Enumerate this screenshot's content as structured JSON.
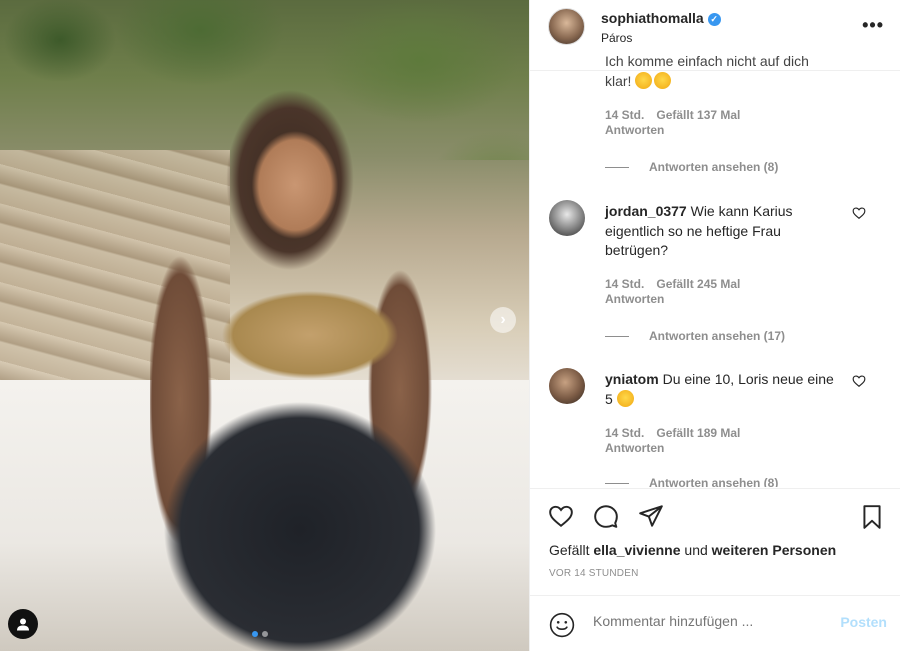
{
  "post": {
    "username": "sophiathomalla",
    "location": "Páros",
    "more_label": "•••"
  },
  "comments": [
    {
      "text_partial": "Ich komme einfach nicht auf dich",
      "text_end": "klar!",
      "time": "14 Std.",
      "likes": "Gefällt 137 Mal",
      "reply": "Antworten",
      "view_replies": "Antworten ansehen (8)"
    },
    {
      "username": "jordan_0377",
      "text": "Wie kann Karius eigentlich so ne heftige Frau betrügen?",
      "time": "14 Std.",
      "likes": "Gefällt 245 Mal",
      "reply": "Antworten",
      "view_replies": "Antworten ansehen (17)"
    },
    {
      "username": "yniatom",
      "text": "Du eine 10, Loris neue eine 5",
      "time": "14 Std.",
      "likes": "Gefällt 189 Mal",
      "reply": "Antworten",
      "view_replies": "Antworten ansehen (8)"
    }
  ],
  "likes": {
    "prefix": "Gefällt",
    "user": "ella_vivienne",
    "middle": "und",
    "suffix": "weiteren Personen"
  },
  "timestamp": "VOR 14 STUNDEN",
  "add_comment": {
    "placeholder": "Kommentar hinzufügen ...",
    "post_label": "Posten"
  },
  "colors": {
    "verified": "#3897f0",
    "muted": "#8e8e8e",
    "post_disabled": "#b2dffc"
  }
}
